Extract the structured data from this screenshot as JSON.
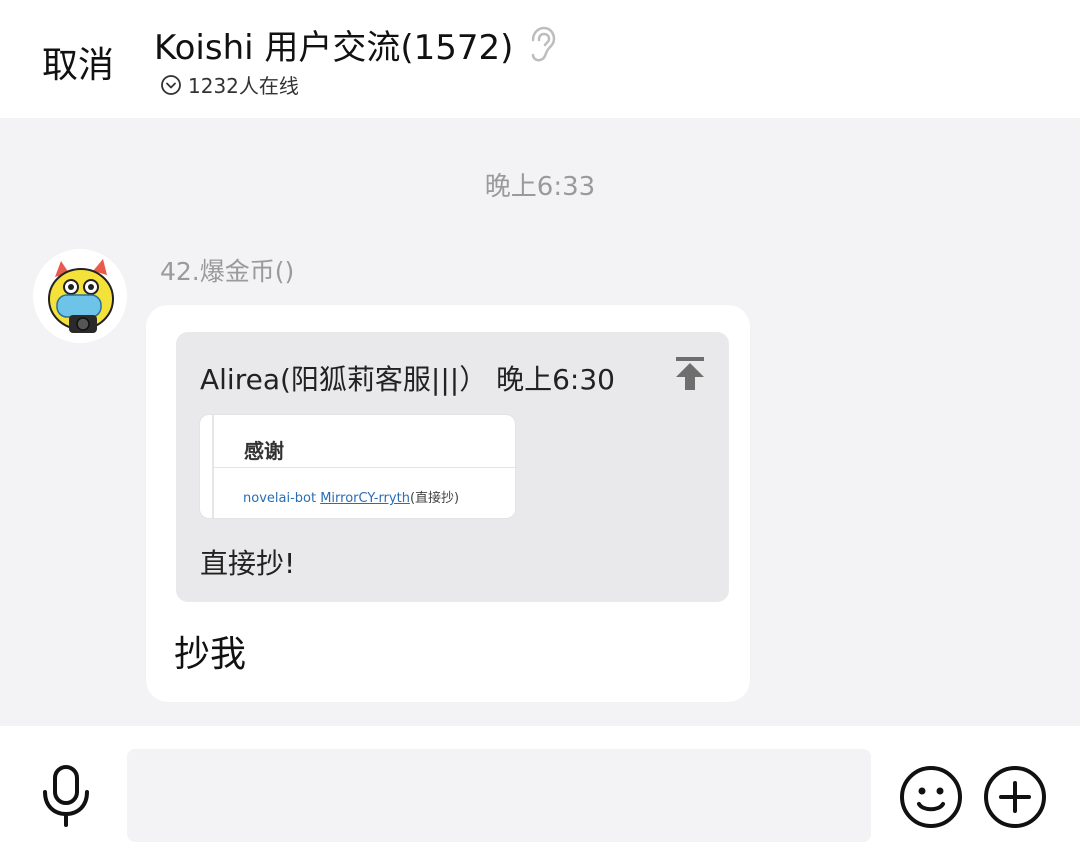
{
  "header": {
    "cancel_label": "取消",
    "title": "Koishi 用户交流(1572)",
    "online": "1232人在线"
  },
  "chat": {
    "time_separator": "晚上6:33",
    "message": {
      "sender": "42.爆金币()",
      "quote": {
        "header": "Alirea(阳狐莉客服|||）  晚上6:30",
        "image": {
          "title": "感谢",
          "line_prefix": "novelai-bot ",
          "line_link": "MirrorCY-rryth",
          "line_suffix": "(直接抄)"
        },
        "body": "直接抄!"
      },
      "text": "抄我"
    }
  },
  "input": {
    "value": "",
    "placeholder": ""
  },
  "icons": {
    "ear": "ear-icon",
    "online_chevron": "chevron-down-circle-icon",
    "pin": "pin-to-top-icon",
    "mic": "microphone-icon",
    "emoji": "smiley-icon",
    "plus": "plus-circle-icon"
  }
}
